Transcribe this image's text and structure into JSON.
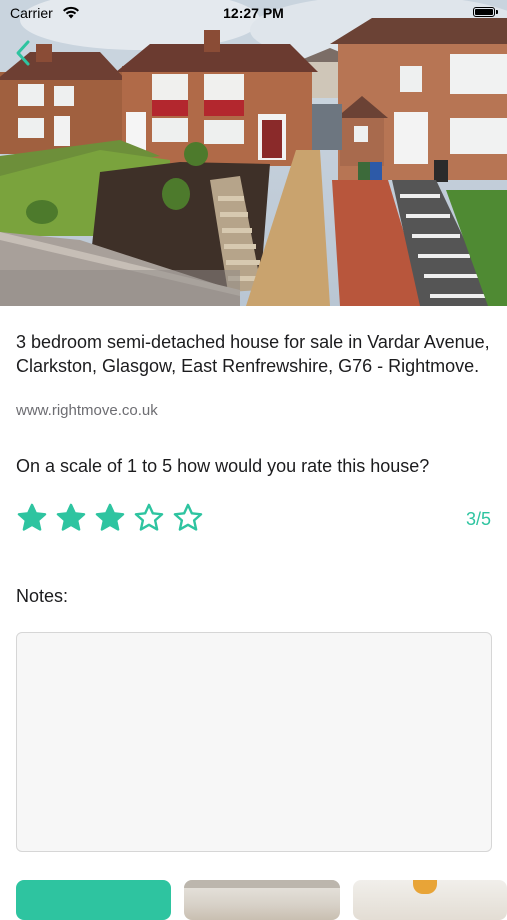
{
  "status_bar": {
    "carrier": "Carrier",
    "time": "12:27 PM"
  },
  "nav": {
    "back_icon": "chevron-left-icon"
  },
  "listing": {
    "photo_alt": "Semi-detached houses on a sloping street",
    "title": "3 bedroom semi-detached house for sale in Vardar Avenue, Clarkston, Glasgow, East Renfrewshire, G76 - Rightmove.",
    "site": "www.rightmove.co.uk"
  },
  "rating": {
    "question": "On a scale of 1 to 5 how would you rate this house?",
    "value": 3,
    "max": 5,
    "display": "3/5"
  },
  "notes": {
    "label": "Notes:",
    "value": ""
  },
  "colors": {
    "accent": "#2ec4a0"
  }
}
